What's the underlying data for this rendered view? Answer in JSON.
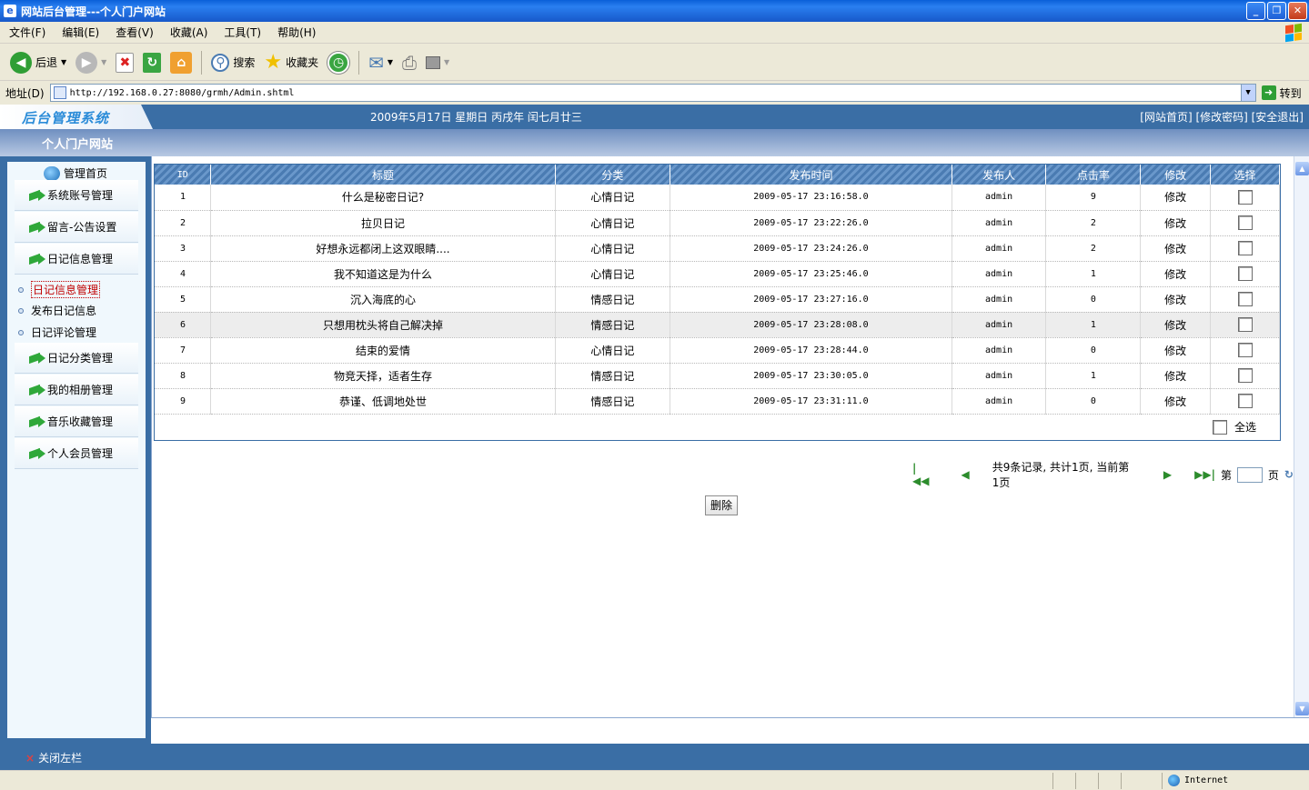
{
  "window": {
    "title": "网站后台管理---个人门户网站"
  },
  "menu": [
    "文件(F)",
    "编辑(E)",
    "查看(V)",
    "收藏(A)",
    "工具(T)",
    "帮助(H)"
  ],
  "toolbar": {
    "back": "后退",
    "search": "搜索",
    "favorites": "收藏夹"
  },
  "address": {
    "label": "地址(D)",
    "url": "http://192.168.0.27:8080/grmh/Admin.shtml",
    "go": "转到"
  },
  "app": {
    "logo": "后台管理系统",
    "date": "2009年5月17日 星期日 丙戌年 闰七月廿三",
    "links": "[网站首页] [修改密码] [安全退出]",
    "site_name": "个人门户网站"
  },
  "sidebar": {
    "home": "管理首页",
    "items": [
      "系统账号管理",
      "留言-公告设置",
      "日记信息管理",
      "日记分类管理",
      "我的相册管理",
      "音乐收藏管理",
      "个人会员管理"
    ],
    "subitems": [
      "日记信息管理",
      "发布日记信息",
      "日记评论管理"
    ],
    "close": "关闭左栏"
  },
  "table": {
    "headers": [
      "ID",
      "标题",
      "分类",
      "发布时间",
      "发布人",
      "点击率",
      "修改",
      "选择"
    ],
    "rows": [
      {
        "id": "1",
        "title": "什么是秘密日记?",
        "category": "心情日记",
        "time": "2009-05-17 23:16:58.0",
        "author": "admin",
        "hits": "9",
        "edit": "修改"
      },
      {
        "id": "2",
        "title": "拉贝日记",
        "category": "心情日记",
        "time": "2009-05-17 23:22:26.0",
        "author": "admin",
        "hits": "2",
        "edit": "修改"
      },
      {
        "id": "3",
        "title": "好想永远都闭上这双眼睛....",
        "category": "心情日记",
        "time": "2009-05-17 23:24:26.0",
        "author": "admin",
        "hits": "2",
        "edit": "修改"
      },
      {
        "id": "4",
        "title": "我不知道这是为什么",
        "category": "心情日记",
        "time": "2009-05-17 23:25:46.0",
        "author": "admin",
        "hits": "1",
        "edit": "修改"
      },
      {
        "id": "5",
        "title": "沉入海底的心",
        "category": "情感日记",
        "time": "2009-05-17 23:27:16.0",
        "author": "admin",
        "hits": "0",
        "edit": "修改"
      },
      {
        "id": "6",
        "title": "只想用枕头将自己解决掉",
        "category": "情感日记",
        "time": "2009-05-17 23:28:08.0",
        "author": "admin",
        "hits": "1",
        "edit": "修改"
      },
      {
        "id": "7",
        "title": "结束的爱情",
        "category": "心情日记",
        "time": "2009-05-17 23:28:44.0",
        "author": "admin",
        "hits": "0",
        "edit": "修改"
      },
      {
        "id": "8",
        "title": "物竞天择，适者生存",
        "category": "情感日记",
        "time": "2009-05-17 23:30:05.0",
        "author": "admin",
        "hits": "1",
        "edit": "修改"
      },
      {
        "id": "9",
        "title": "恭谨、低调地处世",
        "category": "情感日记",
        "time": "2009-05-17 23:31:11.0",
        "author": "admin",
        "hits": "0",
        "edit": "修改"
      }
    ],
    "select_all": "全选"
  },
  "pager": {
    "summary": "共9条记录, 共计1页, 当前第1页",
    "page_prefix": "第",
    "page_suffix": "页",
    "page_value": ""
  },
  "actions": {
    "delete": "删除"
  },
  "status": {
    "zone": "Internet"
  },
  "colors": {
    "header_bg": "#3a6ea5",
    "title_bar": "#1f5fd6",
    "active_link": "#c00000"
  }
}
